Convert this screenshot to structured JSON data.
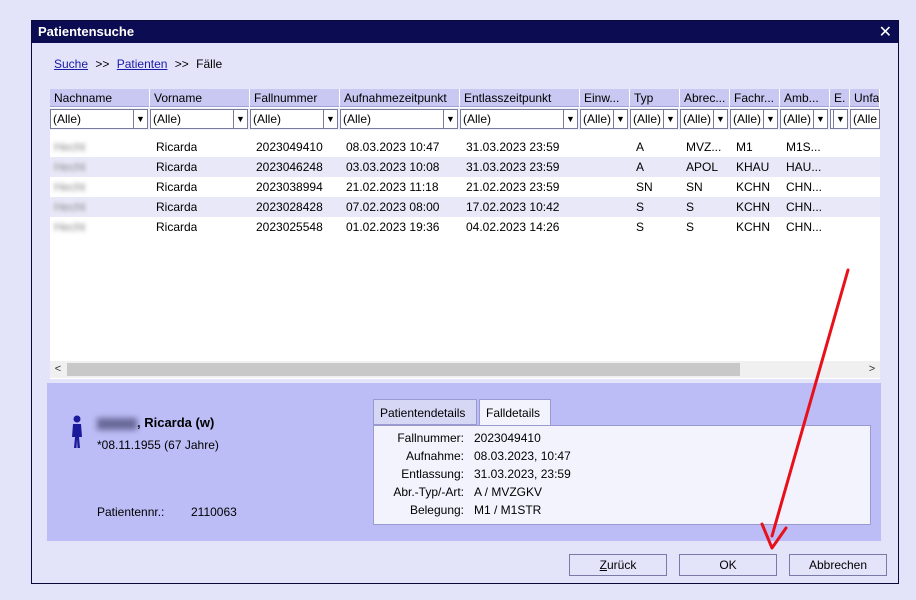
{
  "dialog": {
    "title": "Patientensuche",
    "close_glyph": "✕"
  },
  "breadcrumb": {
    "link1": "Suche",
    "sep1": ">>",
    "link2": "Patienten",
    "sep2": ">>",
    "current": "Fälle"
  },
  "columns": [
    "Nachname",
    "Vorname",
    "Fallnummer",
    "Aufnahmezeitpunkt",
    "Entlasszeitpunkt",
    "Einw...",
    "Typ",
    "Abrec...",
    "Fachr...",
    "Amb...",
    "E.",
    "Unfa"
  ],
  "filters": [
    "(Alle)",
    "(Alle)",
    "(Alle)",
    "(Alle)",
    "(Alle)",
    "(Alle)",
    "(Alle)",
    "(Alle)",
    "(Alle)",
    "(Alle)",
    "(Alle)",
    "(Alle"
  ],
  "rows": [
    [
      "Hecht",
      "Ricarda",
      "2023049410",
      "08.03.2023 10:47",
      "31.03.2023 23:59",
      "",
      "A",
      "MVZ...",
      "M1",
      "M1S...",
      "",
      ""
    ],
    [
      "Hecht",
      "Ricarda",
      "2023046248",
      "03.03.2023 10:08",
      "31.03.2023 23:59",
      "",
      "A",
      "APOL",
      "KHAU",
      "HAU...",
      "",
      ""
    ],
    [
      "Hecht",
      "Ricarda",
      "2023038994",
      "21.02.2023 11:18",
      "21.02.2023 23:59",
      "",
      "SN",
      "SN",
      "KCHN",
      "CHN...",
      "",
      ""
    ],
    [
      "Hecht",
      "Ricarda",
      "2023028428",
      "07.02.2023 08:00",
      "17.02.2023 10:42",
      "",
      "S",
      "S",
      "KCHN",
      "CHN...",
      "",
      ""
    ],
    [
      "Hecht",
      "Ricarda",
      "2023025548",
      "01.02.2023 19:36",
      "04.02.2023 14:26",
      "",
      "S",
      "S",
      "KCHN",
      "CHN...",
      "",
      ""
    ]
  ],
  "scroll": {
    "left": "<",
    "right": ">"
  },
  "patient": {
    "name": ", Ricarda  (w)",
    "dob": "*08.11.1955 (67 Jahre)",
    "nr_label": "Patientennr.:",
    "nr_value": "2110063"
  },
  "tabs": {
    "patient": "Patientendetails",
    "case": "Falldetails"
  },
  "case_details": [
    {
      "k": "Fallnummer:",
      "v": "2023049410"
    },
    {
      "k": "Aufnahme:",
      "v": "08.03.2023, 10:47"
    },
    {
      "k": "Entlassung:",
      "v": "31.03.2023, 23:59"
    },
    {
      "k": "Abr.-Typ/-Art:",
      "v": "A / MVZGKV"
    },
    {
      "k": "Belegung:",
      "v": "M1 / M1STR"
    }
  ],
  "buttons": {
    "back_underlined": "Z",
    "back_rest": "urück",
    "ok": "OK",
    "cancel": "Abbrechen"
  },
  "colors": {
    "titlebar": "#0c0c52",
    "pane": "#bcbcf6",
    "arrow": "#e8101a"
  }
}
